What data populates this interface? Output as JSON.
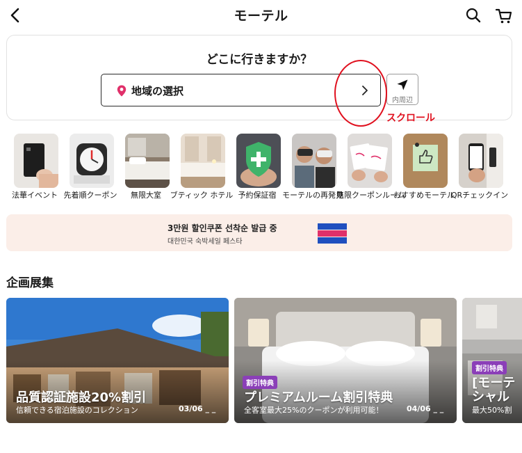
{
  "header": {
    "title": "モーテル",
    "back_icon": "chevron-left-icon",
    "search_icon": "search-icon",
    "cart_icon": "cart-icon"
  },
  "search": {
    "heading": "どこに行きますか？",
    "region_label": "地域の選択",
    "nearby_label": "内周辺"
  },
  "annotation": {
    "text": "スクロール",
    "color": "#e0101e"
  },
  "categories": [
    {
      "label": "法華イベント"
    },
    {
      "label": "先着順クーポン"
    },
    {
      "label": "無限大室"
    },
    {
      "label": "ブティック ホテル"
    },
    {
      "label": "予約保証宿"
    },
    {
      "label": "モーテルの再発見"
    },
    {
      "label": "無限クーポンルーム"
    },
    {
      "label": "おすすめモーテル"
    },
    {
      "label": "QRチェックイン"
    }
  ],
  "banner": {
    "title": "3만원 할인쿠폰 선착순 발급 중",
    "subtitle": "대한민국 숙박세일 페스타",
    "logo_text": "대한민국 숙박세일 페스타"
  },
  "section": {
    "title": "企画展集"
  },
  "feature_cards": [
    {
      "tag": "",
      "title": "品質認証施設20%割引",
      "subtitle": "信頼できる宿泊施設のコレクション",
      "date": "03/06 _ _"
    },
    {
      "tag": "割引特典",
      "title": "プレミアムルーム割引特典",
      "subtitle": "全客室最大25%のクーポンが利用可能！",
      "date": "04/06 _ _"
    },
    {
      "tag": "割引特典",
      "title": "[モーテ",
      "title2": "シャル",
      "subtitle": "最大50%割"
    }
  ],
  "colors": {
    "pin": "#e0306a",
    "banner_bg": "#fbeee8",
    "tag_bg": "#8b3fb8",
    "annotation": "#e0101e"
  }
}
